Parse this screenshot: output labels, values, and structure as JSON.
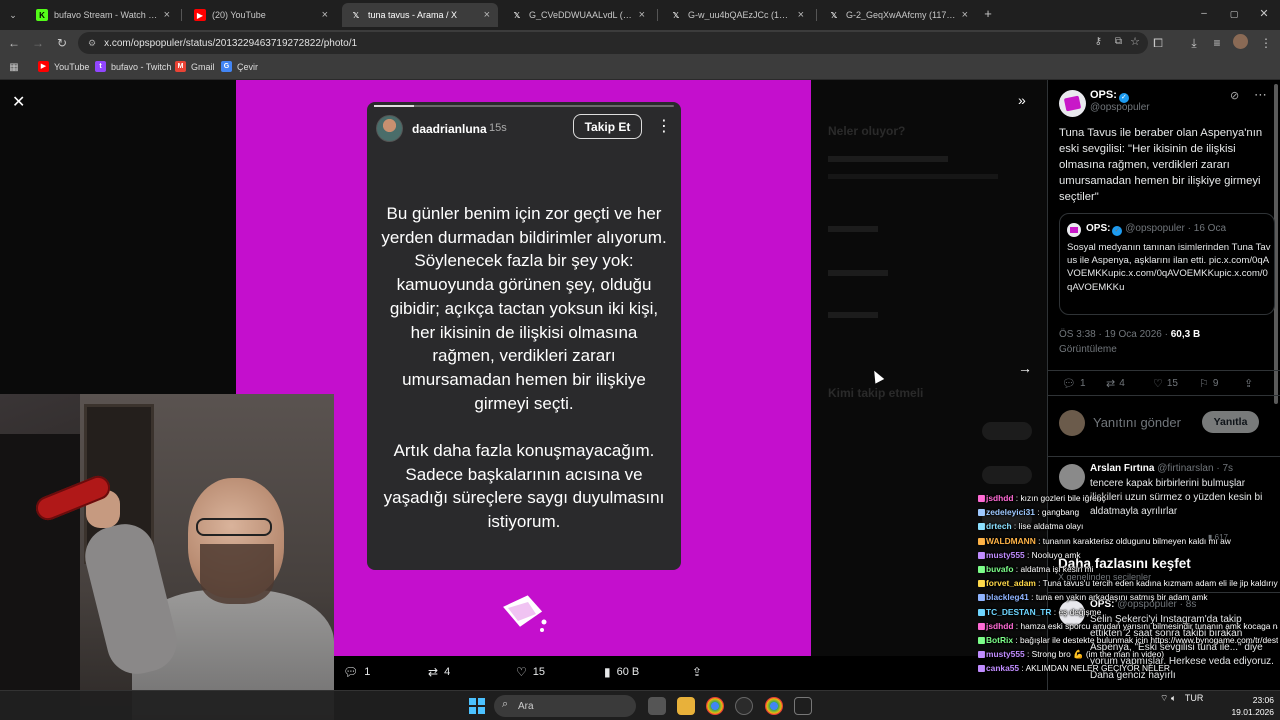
{
  "tabs": [
    {
      "title": "bufavo Stream - Watch Live on",
      "favicon": "kick-icon",
      "color": "#53fc18"
    },
    {
      "title": "(20) YouTube",
      "favicon": "youtube-icon",
      "color": "#ff0000"
    },
    {
      "title": "tuna tavus - Arama / X",
      "favicon": "x-icon",
      "color": "#000000"
    },
    {
      "title": "G_CVeDDWUAALvdL (922×2048)",
      "favicon": "x-icon",
      "color": "#000000"
    },
    {
      "title": "G-w_uu4bQAEzJCc (1440×1920)",
      "favicon": "x-icon",
      "color": "#000000"
    },
    {
      "title": "G-2_GeqXwAAfcmy (1179×1334)",
      "favicon": "x-icon",
      "color": "#000000"
    }
  ],
  "address": {
    "url": "x.com/opspopuler/status/2013229463719272822/photo/1"
  },
  "bookmarks": [
    {
      "label": "YouTube",
      "icon": "youtube-icon",
      "color": "#ff0000"
    },
    {
      "label": "bufavo - Twitch",
      "icon": "twitch-icon",
      "color": "#9146ff"
    },
    {
      "label": "Gmail",
      "icon": "gmail-icon",
      "color": "#ea4335"
    },
    {
      "label": "Çevir",
      "icon": "translate-icon",
      "color": "#4285f4"
    }
  ],
  "story": {
    "username": "daadrianluna",
    "time": "15s",
    "follow_label": "Takip Et",
    "paragraph1": "Bu günler benim için zor geçti ve her yerden durmadan bildirimler alıyorum. Söylenecek fazla bir şey yok: kamuoyunda görünen şey, olduğu gibidir; açıkça tactan yoksun iki kişi, her ikisinin de ilişkisi olmasına rağmen, verdikleri zararı umursamadan hemen bir ilişkiye girmeyi seçti.",
    "paragraph2": "Artık daha fazla konuşmayacağım. Sadece başkalarının acısına ve yaşadığı süreçlere saygı duyulmasını istiyorum."
  },
  "photo_actions": {
    "replies": "1",
    "retweets": "4",
    "likes": "15",
    "views": "60 B"
  },
  "background_page": {
    "heading": "Neler oluyor?",
    "follow_heading": "Kimi takip etmeli"
  },
  "tweet": {
    "name": "OPS:",
    "handle": "@opspopuler",
    "text": "Tuna Tavus ile beraber olan Aspenya'nın eski sevgilisi: \"Her ikisinin de ilişkisi olmasına rağmen, verdikleri zararı umursamadan hemen bir ilişkiye girmeyi seçtiler\"",
    "quote": {
      "name": "OPS:",
      "handle": "@opspopuler",
      "date": "16 Oca",
      "text": "Sosyal medyanın tanınan isimlerinden Tuna Tavus ile Aspenya, aşklarını ilan etti. pic.x.com/0qAVOEMKKupic.x.com/0qAVOEMKKupic.x.com/0qAVOEMKKu"
    },
    "timestamp": "ÖS 3:38 · 19 Oca 2026",
    "views_count": "60,3 B",
    "views_label": "Görüntüleme",
    "actions": {
      "replies": "1",
      "retweets": "4",
      "likes": "15",
      "bookmarks": "9"
    },
    "reply_placeholder": "Yanıtını gönder",
    "reply_button": "Yanıtla"
  },
  "replies": [
    {
      "name": "Arslan Fırtına",
      "handle": "@firtinarslan",
      "time": "7s",
      "text": "tencere kapak birbirlerini bulmuşlar ilişkileri uzun sürmez o yüzden kesin bi aldatmayla ayrılırlar",
      "stats": "617"
    },
    {
      "name": "OPS:",
      "handle": "@opspopuler",
      "time": "8s",
      "text": "Selin Şekerci'yi Instagram'da takip ettikten 2 saat sonra takibi bırakan Aspenya, \"Eski sevgilisi tuna ile...\" diye yorum yapmışlar. Herkese veda ediyoruz. Daha genciz hayırlı"
    }
  ],
  "discover": {
    "title": "Daha fazlasını keşfet",
    "subtitle": "X genelinden seçilenler"
  },
  "chat": [
    {
      "user": "jsdhdd",
      "color": "#ff6bd5",
      "msg": "kızın gozleri bile iğrenç"
    },
    {
      "user": "zedeleyici31",
      "color": "#9ec9ff",
      "msg": "gangbang"
    },
    {
      "user": "drtech",
      "color": "#8be0ff",
      "msg": "lise aldatma olayı"
    },
    {
      "user": "WALDMANN",
      "color": "#ffb347",
      "msg": "tunanın karakterisz oldugunu bilmeyen kaldı mı aw"
    },
    {
      "user": "musty555",
      "color": "#c08cff",
      "msg": "Nooluyo amk"
    },
    {
      "user": "buvafo",
      "color": "#7dff8a",
      "msg": "aldatma işi kesin mi"
    },
    {
      "user": "forvet_adam",
      "color": "#ffd94a",
      "msg": "Tuna tavus'u tercih eden kadına kızmam adam eli ile jip kaldırıyor"
    },
    {
      "user": "blackleg41",
      "color": "#8fb4ff",
      "msg": "tuna en yakın arkadaşını satmış bir adam amk"
    },
    {
      "user": "TC_DESTAN_TR",
      "color": "#6fd6ff",
      "msg": "eş değişme"
    },
    {
      "user": "jsdhdd",
      "color": "#ff6bd5",
      "msg": "hamza eski sporcu amıdan yarısını bilmesindir tunanın amk kocaga nasıl ayıp ettıgını zaten bu adamda karakter yok"
    },
    {
      "user": "BotRix",
      "color": "#7dff8a",
      "msg": "bağışlar ile destekte bulunmak için https://www.bynogame.com/tr/destekle/bufavo"
    },
    {
      "user": "musty555",
      "color": "#c08cff",
      "msg": "Strong bro 💪 (im the man in video)"
    },
    {
      "user": "canka55",
      "color": "#c08cff",
      "msg": "AKLIMDAN NELER GEÇIYOR NELER"
    }
  ],
  "taskbar": {
    "search_label": "Ara",
    "lang": "TUR",
    "time": "23:06",
    "date": "19.01.2026"
  }
}
